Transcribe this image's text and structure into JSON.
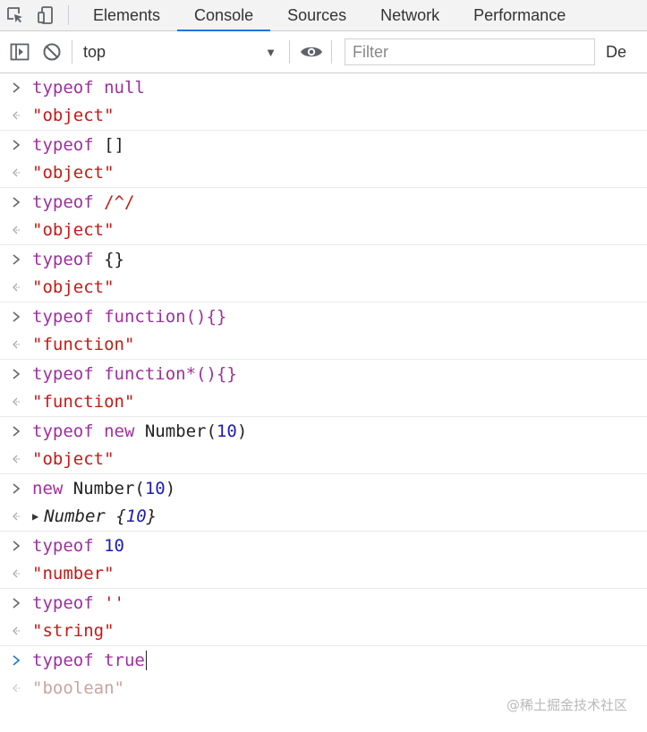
{
  "tabbar": {
    "tabs": [
      {
        "label": "Elements"
      },
      {
        "label": "Console"
      },
      {
        "label": "Sources"
      },
      {
        "label": "Network"
      },
      {
        "label": "Performance"
      }
    ],
    "active_tab": "Console"
  },
  "toolbar": {
    "context": "top",
    "filter_placeholder": "Filter",
    "levels_label": "De"
  },
  "console": {
    "entries": [
      {
        "input": [
          "typeof",
          " null"
        ],
        "output": "\"object\""
      },
      {
        "input": [
          "typeof",
          " []"
        ],
        "output": "\"object\""
      },
      {
        "input": [
          "typeof",
          " /^/"
        ],
        "output": "\"object\""
      },
      {
        "input": [
          "typeof",
          " {}"
        ],
        "output": "\"object\""
      },
      {
        "input": [
          "typeof",
          " function(){}"
        ],
        "output": "\"function\""
      },
      {
        "input": [
          "typeof",
          " function*(){}"
        ],
        "output": "\"function\""
      },
      {
        "input": [
          "typeof",
          " new",
          " Number(",
          "10",
          ")"
        ],
        "output": "\"object\""
      },
      {
        "input": [
          "new",
          " Number(",
          "10",
          ")"
        ],
        "output_obj": [
          "Number ",
          "{",
          "10",
          "}"
        ]
      },
      {
        "input": [
          "typeof",
          " 10"
        ],
        "output": "\"number\""
      },
      {
        "input": [
          "typeof",
          " ''"
        ],
        "output": "\"string\""
      },
      {
        "input": [
          "typeof",
          " true"
        ],
        "output": "\"boolean\""
      }
    ]
  },
  "watermark": "@稀土掘金技术社区",
  "colors": {
    "keyword": "#9e2f9e",
    "number": "#1c1cb5",
    "string": "#c41a16",
    "active_tab_underline": "#1a73e8"
  }
}
